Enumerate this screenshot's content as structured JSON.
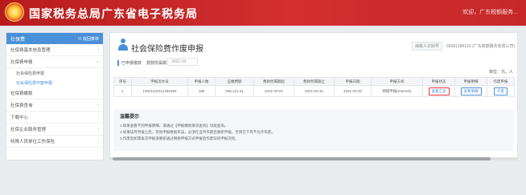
{
  "header": {
    "site_title": "国家税务总局广东省电子税务局",
    "welcome": "欢迎，广东税额服务..."
  },
  "sidebar": {
    "title": "社保费",
    "collapse_label": "收回菜单",
    "items": [
      {
        "label": "社保费基本信息管理",
        "expandable": true
      },
      {
        "label": "社保费申报",
        "expandable": true
      },
      {
        "label": "社会保险费申报",
        "expandable": false,
        "sub": true,
        "active": false
      },
      {
        "label": "社会保险费作废申报",
        "expandable": false,
        "sub": true,
        "active": true
      },
      {
        "label": "社保费缴款",
        "expandable": true
      },
      {
        "label": "社保费查询",
        "expandable": true
      },
      {
        "label": "下载中心",
        "expandable": true
      },
      {
        "label": "社保企业服务管理",
        "expandable": true
      },
      {
        "label": "特殊人员单位工伤保险",
        "expandable": true
      }
    ]
  },
  "page": {
    "title": "社会保险费作废申报",
    "taxpayer_label": "纳税人识别号",
    "taxpayer_value": "92581388130 (广东税额服务有限公司)"
  },
  "filter": {
    "label_taxpayer": "已申报缴款",
    "label_period": "费款所属期",
    "period_value": "2021-03"
  },
  "unit_label": "单位：元，人",
  "table": {
    "headers": [
      "序号",
      "申报流水号",
      "申报人数",
      "应缴费额",
      "费款所属期起",
      "费款所属期止",
      "申报日期",
      "申报方式",
      "申报状态",
      "申报明细",
      "作废申报"
    ],
    "rows": [
      {
        "index": "1",
        "serial": "10021102114456490",
        "people": "186",
        "amount": "568,121.21",
        "period_start": "2021-03-01",
        "period_end": "2021-03-31",
        "declare_date": "2021-03-30",
        "method": "网络申报(Internet)",
        "status_btn": "查看汇总",
        "detail_btn": "查看明细",
        "void_btn": "作废"
      }
    ]
  },
  "tips": {
    "title": "温馨提示",
    "lines": [
      "1.如果查看不到申报明细，请通过【申报缴款情况查询】功能查询。",
      "2.如果该月申报之后，其他申报数据有误，必须在当月作废后重新申报，否则在下月不允许作废。",
      "3.作废后如需再次申报请重新通过网络申报方式申报后作废前的申报流程。"
    ]
  },
  "colors": {
    "banner": "#c62828",
    "accent": "#4a90d9",
    "highlight": "#e53935"
  }
}
